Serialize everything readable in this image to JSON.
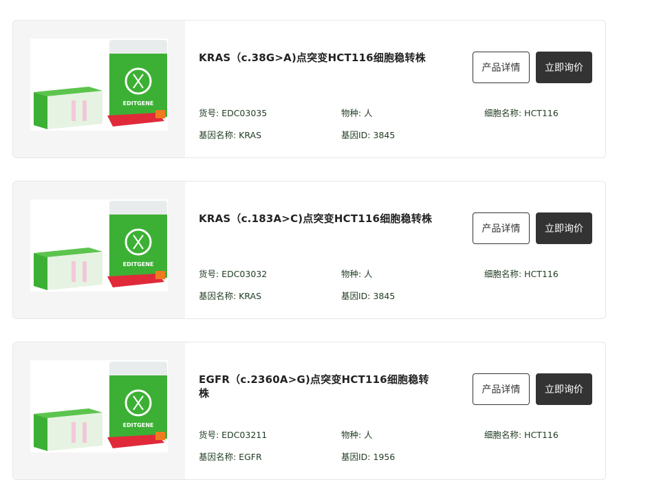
{
  "products": [
    {
      "title": "KRAS（c.38G>A)点突变HCT116细胞稳转株",
      "catalog": "货号: EDC03035",
      "species": "物种: 人",
      "cell_name": "细胞名称: HCT116",
      "gene_name": "基因名称: KRAS",
      "gene_id": "基因ID: 3845",
      "detail_label": "产品详情",
      "inquire_label": "立即询价",
      "image_brand": "EDITGENE"
    },
    {
      "title": "KRAS（c.183A>C)点突变HCT116细胞稳转株",
      "catalog": "货号: EDC03032",
      "species": "物种: 人",
      "cell_name": "细胞名称: HCT116",
      "gene_name": "基因名称: KRAS",
      "gene_id": "基因ID: 3845",
      "detail_label": "产品详情",
      "inquire_label": "立即询价",
      "image_brand": "EDITGENE"
    },
    {
      "title": "EGFR（c.2360A>G)点突变HCT116细胞稳转株",
      "catalog": "货号: EDC03211",
      "species": "物种: 人",
      "cell_name": "细胞名称: HCT116",
      "gene_name": "基因名称: EGFR",
      "gene_id": "基因ID: 1956",
      "detail_label": "产品详情",
      "inquire_label": "立即询价",
      "image_brand": "EDITGENE"
    }
  ],
  "colors": {
    "brand_green": "#3cb034",
    "button_dark": "#333333",
    "meta_text": "#1f3a20"
  }
}
